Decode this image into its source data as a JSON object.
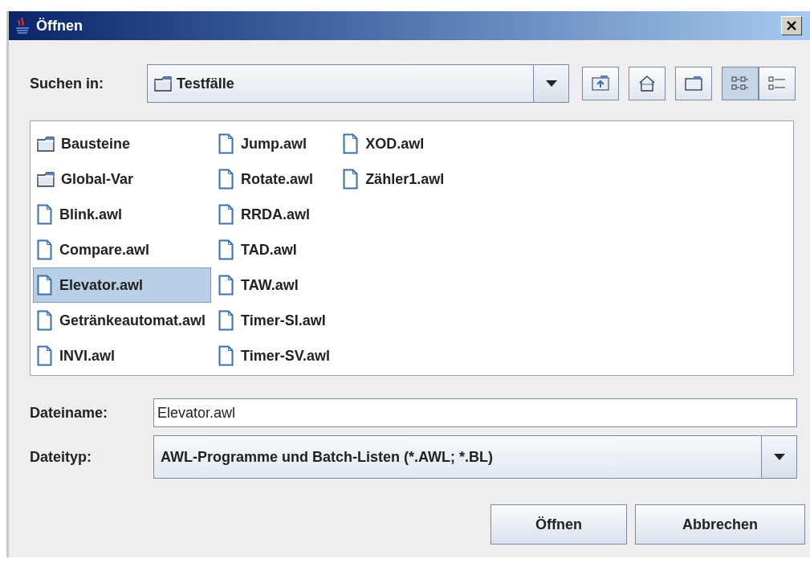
{
  "window": {
    "title": "Öffnen"
  },
  "look_in": {
    "label": "Suchen in:",
    "value": "Testfälle"
  },
  "toolbar": [
    {
      "kind": "up"
    },
    {
      "kind": "home"
    },
    {
      "kind": "new-folder"
    },
    {
      "kind": "list",
      "selected": true
    },
    {
      "kind": "details",
      "selected": false
    }
  ],
  "files": [
    {
      "name": "Bausteine",
      "kind": "folder",
      "selected": false
    },
    {
      "name": "Global-Var",
      "kind": "folder",
      "selected": false
    },
    {
      "name": "Blink.awl",
      "kind": "file",
      "selected": false
    },
    {
      "name": "Compare.awl",
      "kind": "file",
      "selected": false
    },
    {
      "name": "Elevator.awl",
      "kind": "file",
      "selected": true
    },
    {
      "name": "Getränkeautomat.awl",
      "kind": "file",
      "selected": false
    },
    {
      "name": "INVI.awl",
      "kind": "file",
      "selected": false
    },
    {
      "name": "Jump.awl",
      "kind": "file",
      "selected": false
    },
    {
      "name": "Rotate.awl",
      "kind": "file",
      "selected": false
    },
    {
      "name": "RRDA.awl",
      "kind": "file",
      "selected": false
    },
    {
      "name": "TAD.awl",
      "kind": "file",
      "selected": false
    },
    {
      "name": "TAW.awl",
      "kind": "file",
      "selected": false
    },
    {
      "name": "Timer-SI.awl",
      "kind": "file",
      "selected": false
    },
    {
      "name": "Timer-SV.awl",
      "kind": "file",
      "selected": false
    },
    {
      "name": "XOD.awl",
      "kind": "file",
      "selected": false
    },
    {
      "name": "Zähler1.awl",
      "kind": "file",
      "selected": false
    }
  ],
  "file_name": {
    "label": "Dateiname:",
    "value": "Elevator.awl"
  },
  "file_type": {
    "label": "Dateityp:",
    "value": "AWL-Programme und Batch-Listen (*.AWL; *.BL)"
  },
  "buttons": [
    "Öffnen",
    "Abbrechen"
  ]
}
